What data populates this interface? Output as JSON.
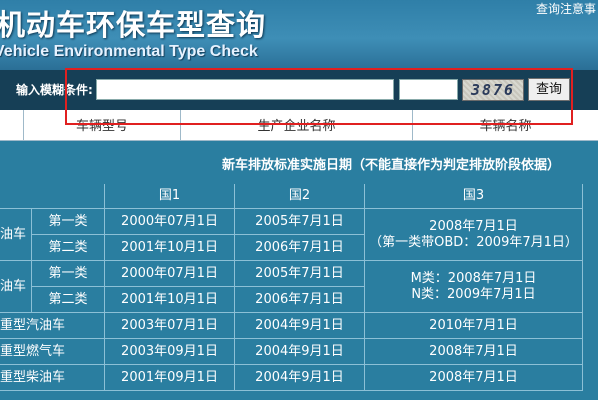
{
  "header": {
    "title": "机动车环保车型查询",
    "subtitle": "Vehicle Environmental Type Check",
    "notice_link": "查询注意事"
  },
  "search": {
    "label": "输入模糊条件:",
    "query_value": "",
    "captcha_value": "",
    "captcha_text": "3876",
    "query_button": "查询"
  },
  "columns": [
    "车辆型号",
    "生产企业名称",
    "车辆名称"
  ],
  "standards_table": {
    "heading": "新车排放标准实施日期（不能直接作为判定排放阶段依据）",
    "headers": [
      "国1",
      "国2",
      "国3"
    ],
    "rows": [
      {
        "group": "油车",
        "class": "第一类",
        "g1": "2000年07月1日",
        "g2": "2005年7月1日"
      },
      {
        "group": "",
        "class": "第二类",
        "g1": "2001年10月1日",
        "g2": "2006年7月1日"
      },
      {
        "group": "油车",
        "class": "第一类",
        "g1": "2000年07月1日",
        "g2": "2005年7月1日"
      },
      {
        "group": "",
        "class": "第二类",
        "g1": "2001年10月1日",
        "g2": "2006年7月1日"
      },
      {
        "group": "重型汽油车",
        "class": "",
        "g1": "2003年07月1日",
        "g2": "2004年9月1日",
        "g3": "2010年7月1日"
      },
      {
        "group": "重型燃气车",
        "class": "",
        "g1": "2003年09月1日",
        "g2": "2004年9月1日",
        "g3": "2008年7月1日"
      },
      {
        "group": "重型柴油车",
        "class": "",
        "g1": "2001年09月1日",
        "g2": "2004年9月1日",
        "g3": "2008年7月1日"
      }
    ],
    "g3_merged_1_line1": "2008年7月1日",
    "g3_merged_1_line2": "（第一类带OBD：2009年7月1日）",
    "g3_merged_2_line1": "M类：2008年7月1日",
    "g3_merged_2_line2": "N类：2009年7月1日"
  }
}
